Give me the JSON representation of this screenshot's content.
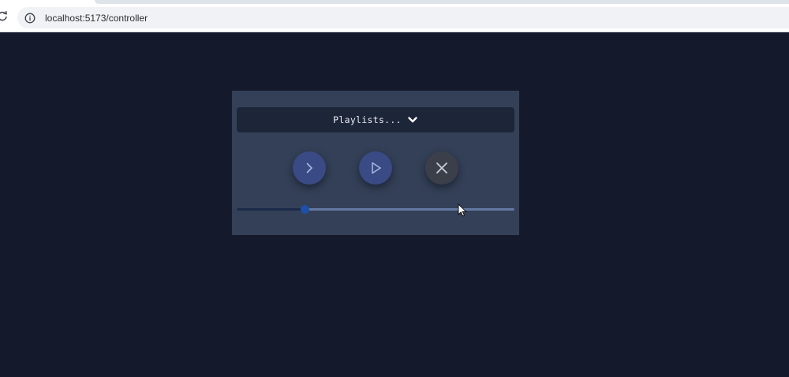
{
  "browser": {
    "url": "localhost:5173/controller",
    "icons": [
      "reload-icon",
      "info-icon"
    ]
  },
  "controller": {
    "playlist_label": "Playlists...",
    "dropdown_icon": "chevron-down-icon",
    "buttons": [
      {
        "name": "next",
        "icon": "chevron-right-icon"
      },
      {
        "name": "play",
        "icon": "play-icon"
      },
      {
        "name": "close",
        "icon": "close-icon"
      }
    ],
    "seek": {
      "progress": 0.245
    },
    "colors": {
      "page_background": "#141a2b",
      "panel_background": "#344057",
      "dropdown_background": "#1d2638",
      "button_accent": "#3a4a85",
      "thumb": "#1f4fa6"
    }
  }
}
